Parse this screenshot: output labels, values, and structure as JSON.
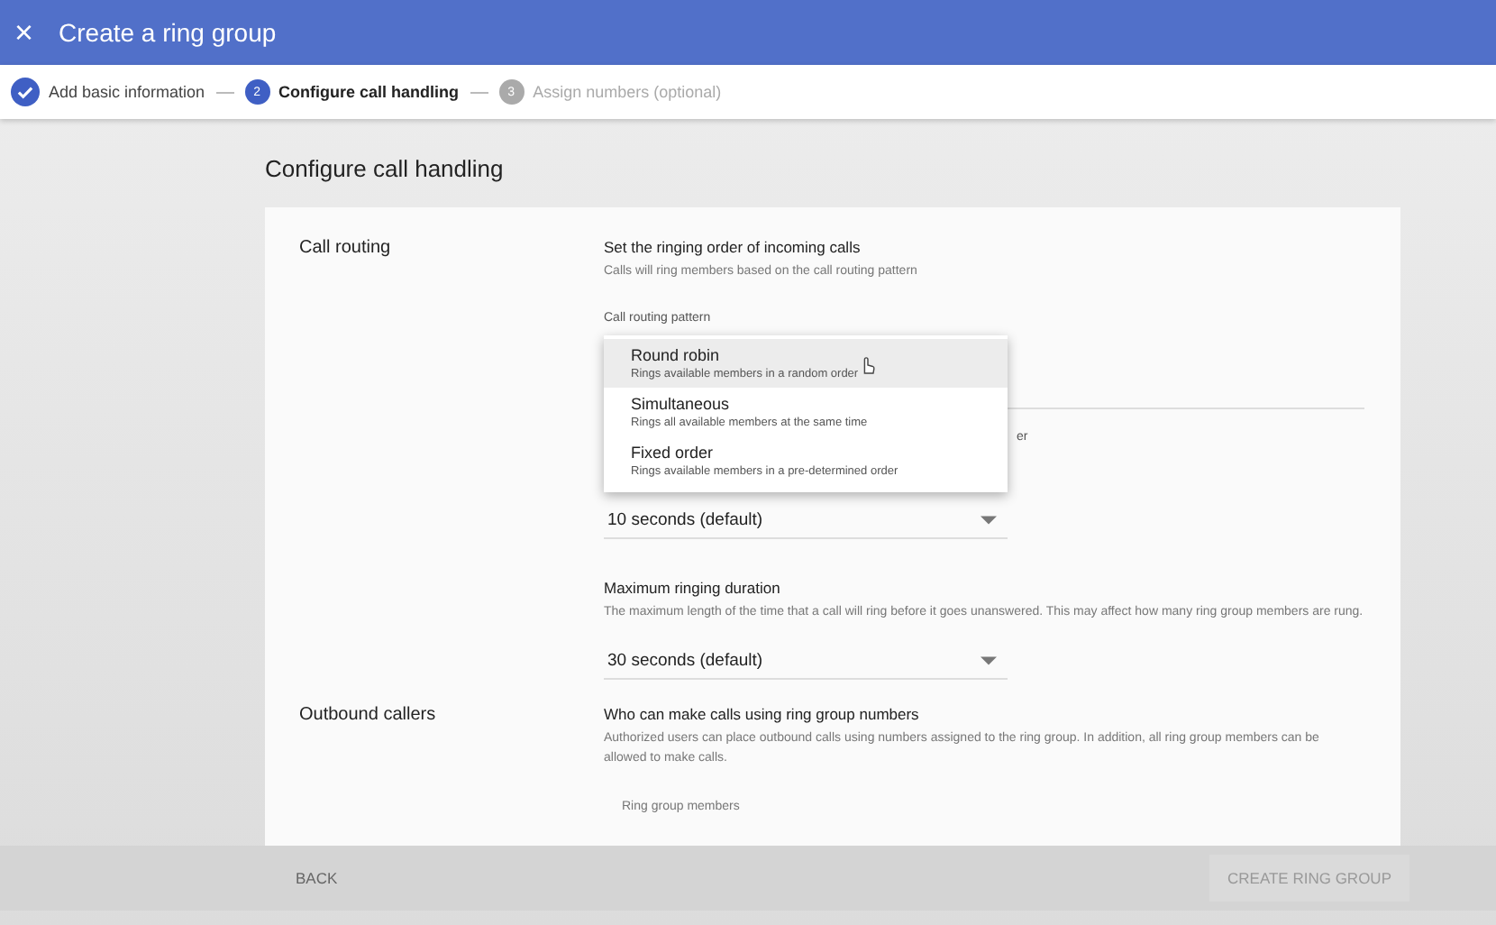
{
  "window": {
    "title": "Create a ring group",
    "close_icon": "×"
  },
  "steps": [
    {
      "label": "Add basic information",
      "kind": "done"
    },
    {
      "label": "Configure call handling",
      "number": "2",
      "kind": "current"
    },
    {
      "label": "Assign numbers (optional)",
      "number": "3",
      "kind": "upcoming"
    }
  ],
  "page_title": "Configure call handling",
  "call_routing": {
    "label": "Call routing",
    "heading": "Set the ringing order of incoming calls",
    "description": "Calls will ring members based on the call routing pattern",
    "field_label": "Call routing pattern",
    "menu": [
      {
        "title": "Round robin",
        "description": "Rings available members in a random order",
        "selected": true
      },
      {
        "title": "Simultaneous",
        "description": "Rings all available members at the same time",
        "selected": false
      },
      {
        "title": "Fixed order",
        "description": "Rings available members in a pre-determined order",
        "selected": false
      }
    ],
    "covered_label": "er",
    "ring_value": "10 seconds (default)"
  },
  "max_duration": {
    "heading": "Maximum ringing duration",
    "description": "The maximum length of the time that a call will ring before it goes unanswered. This may affect how many ring group members are rung.",
    "value": "30 seconds (default)"
  },
  "outbound": {
    "label": "Outbound callers",
    "heading": "Who can make calls using ring group numbers",
    "description": "Authorized users can place outbound calls using numbers assigned to the ring group. In addition, all ring group members can be allowed to make calls.",
    "field_label": "Ring group members"
  },
  "footer": {
    "back": "BACK",
    "create": "CREATE RING GROUP",
    "create_disabled": true
  }
}
